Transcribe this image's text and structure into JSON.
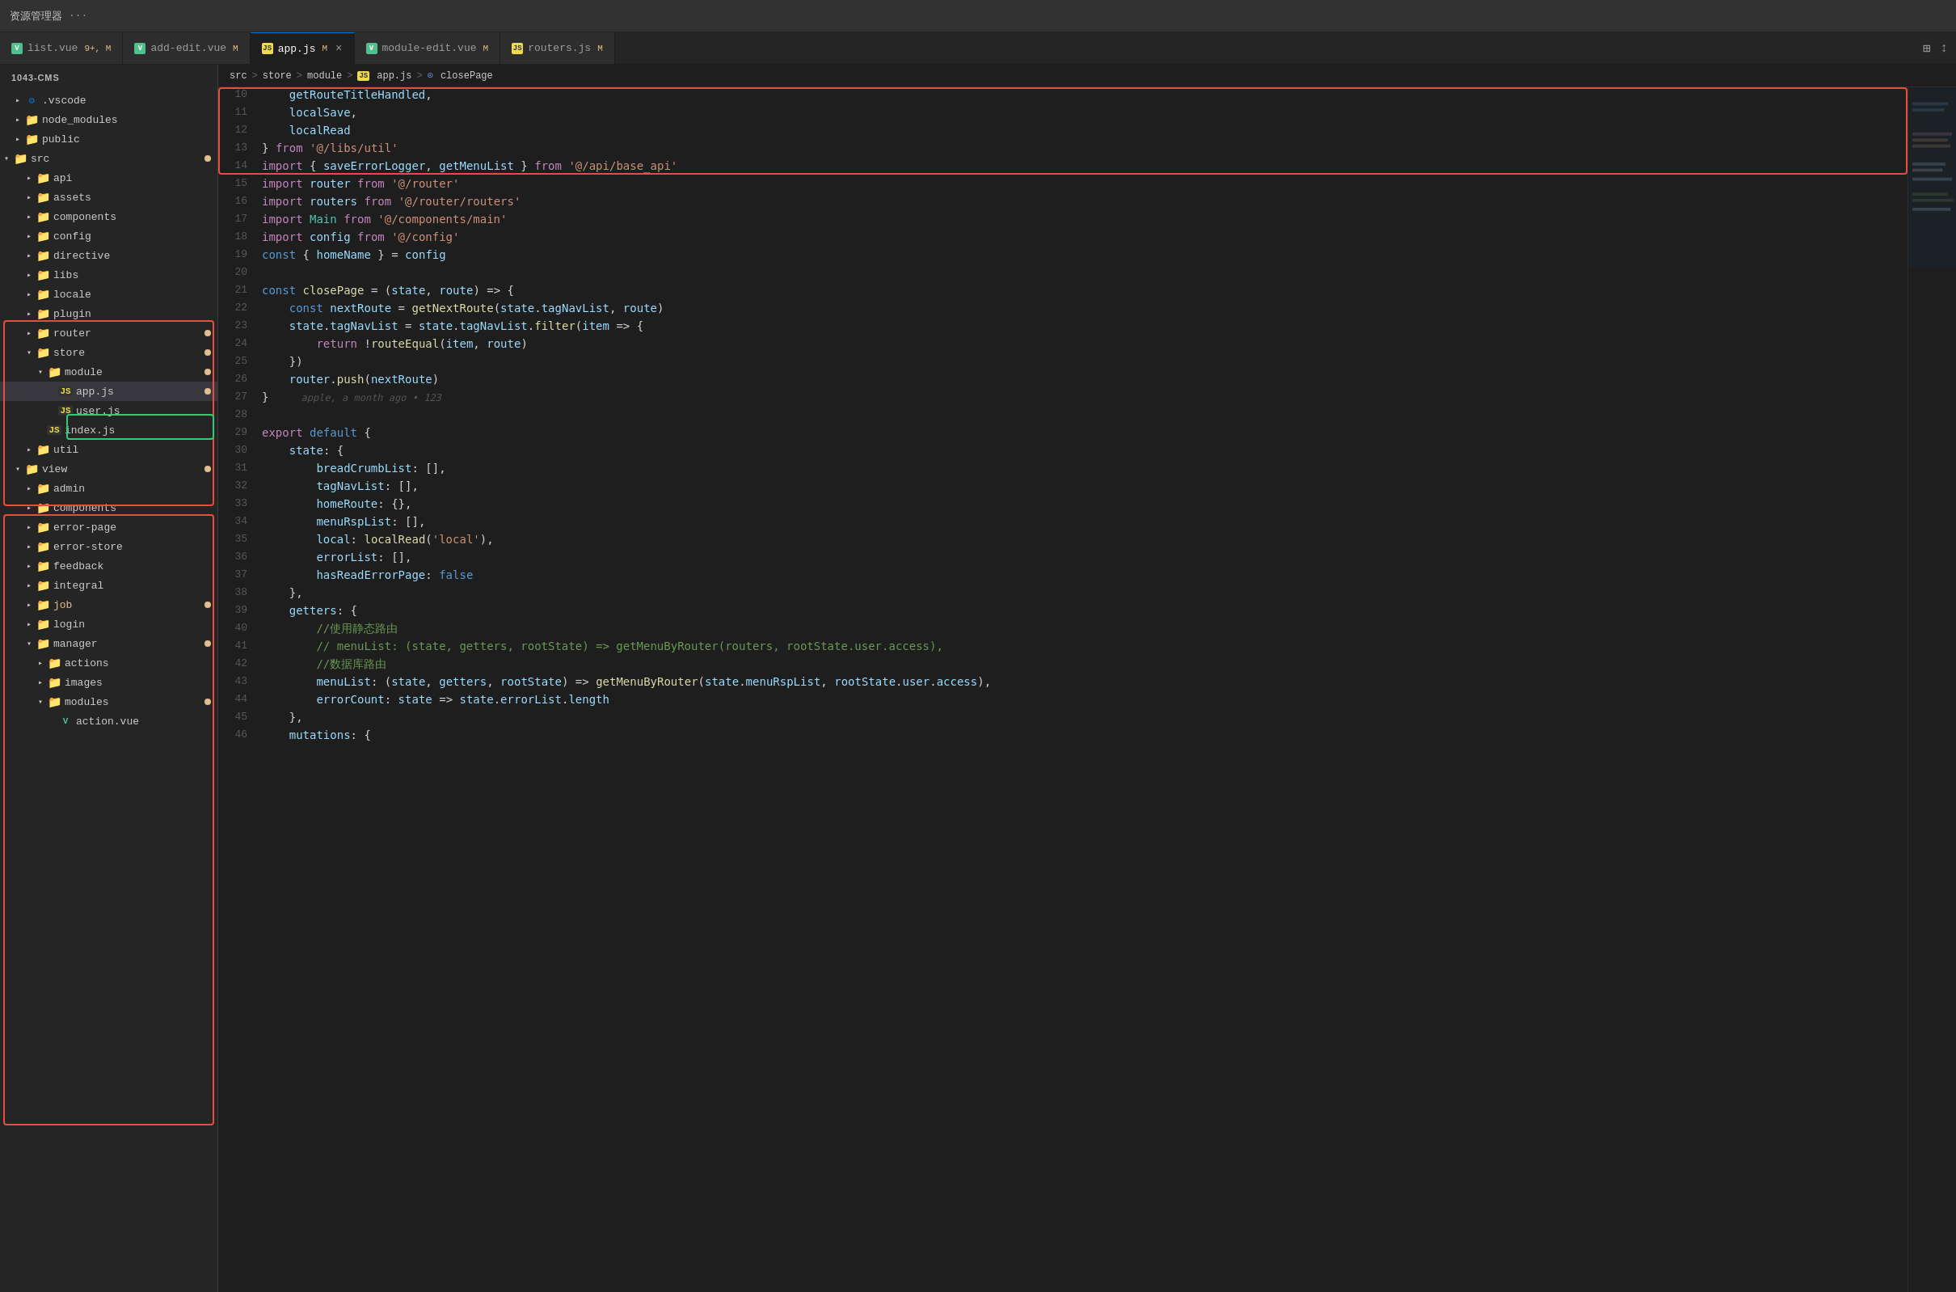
{
  "titleBar": {
    "explorerLabel": "资源管理器",
    "dotsLabel": "···"
  },
  "tabs": [
    {
      "id": "list-vue",
      "icon": "vue",
      "label": "list.vue",
      "badge": "9+, M",
      "active": false,
      "closeable": false
    },
    {
      "id": "add-edit-vue",
      "icon": "vue",
      "label": "add-edit.vue",
      "badge": "M",
      "active": false,
      "closeable": false
    },
    {
      "id": "app-js",
      "icon": "js",
      "label": "app.js",
      "badge": "M",
      "active": true,
      "closeable": true
    },
    {
      "id": "module-edit-vue",
      "icon": "vue",
      "label": "module-edit.vue",
      "badge": "M",
      "active": false,
      "closeable": false
    },
    {
      "id": "routers-js",
      "icon": "js",
      "label": "routers.js",
      "badge": "M",
      "active": false,
      "closeable": false
    }
  ],
  "breadcrumb": {
    "parts": [
      "src",
      ">",
      "store",
      ">",
      "module",
      ">",
      "JS app.js",
      ">",
      "closePage"
    ]
  },
  "sidebar": {
    "title": "1043-CMS",
    "items": [
      {
        "id": "vscode",
        "label": ".vscode",
        "type": "dir",
        "indent": 1,
        "open": false,
        "icon": "vscode"
      },
      {
        "id": "node_modules",
        "label": "node_modules",
        "type": "dir",
        "indent": 1,
        "open": false,
        "icon": "folder-special"
      },
      {
        "id": "public",
        "label": "public",
        "type": "dir",
        "indent": 1,
        "open": false,
        "icon": "folder"
      },
      {
        "id": "src",
        "label": "src",
        "type": "dir",
        "indent": 0,
        "open": true,
        "icon": "folder-special",
        "modified": true
      },
      {
        "id": "api",
        "label": "api",
        "type": "dir",
        "indent": 2,
        "open": false,
        "icon": "folder"
      },
      {
        "id": "assets",
        "label": "assets",
        "type": "dir",
        "indent": 2,
        "open": false,
        "icon": "folder-special"
      },
      {
        "id": "components",
        "label": "components",
        "type": "dir",
        "indent": 2,
        "open": false,
        "icon": "folder-special"
      },
      {
        "id": "config",
        "label": "config",
        "type": "dir",
        "indent": 2,
        "open": false,
        "icon": "folder"
      },
      {
        "id": "directive",
        "label": "directive",
        "type": "dir",
        "indent": 2,
        "open": false,
        "icon": "folder"
      },
      {
        "id": "libs",
        "label": "libs",
        "type": "dir",
        "indent": 2,
        "open": false,
        "icon": "folder"
      },
      {
        "id": "locale",
        "label": "locale",
        "type": "dir",
        "indent": 2,
        "open": false,
        "icon": "folder-special"
      },
      {
        "id": "plugin",
        "label": "plugin",
        "type": "dir",
        "indent": 2,
        "open": false,
        "icon": "folder"
      },
      {
        "id": "router",
        "label": "router",
        "type": "dir",
        "indent": 2,
        "open": false,
        "icon": "folder",
        "modified": true
      },
      {
        "id": "store",
        "label": "store",
        "type": "dir",
        "indent": 2,
        "open": true,
        "icon": "folder",
        "modified": true
      },
      {
        "id": "module",
        "label": "module",
        "type": "dir",
        "indent": 3,
        "open": true,
        "icon": "folder-special",
        "modified": true
      },
      {
        "id": "app-js-file",
        "label": "app.js",
        "type": "file-js",
        "indent": 4,
        "selected": true,
        "modified": true
      },
      {
        "id": "user-js-file",
        "label": "user.js",
        "type": "file-js",
        "indent": 4
      },
      {
        "id": "index-js-file",
        "label": "index.js",
        "type": "file-js",
        "indent": 3
      },
      {
        "id": "util",
        "label": "util",
        "type": "dir",
        "indent": 2,
        "open": false,
        "icon": "folder-special"
      },
      {
        "id": "view",
        "label": "view",
        "type": "dir",
        "indent": 1,
        "open": true,
        "icon": "folder-special",
        "modified": true
      },
      {
        "id": "admin",
        "label": "admin",
        "type": "dir",
        "indent": 2,
        "open": false,
        "icon": "folder"
      },
      {
        "id": "components2",
        "label": "components",
        "type": "dir",
        "indent": 2,
        "open": false,
        "icon": "folder-special"
      },
      {
        "id": "error-page",
        "label": "error-page",
        "type": "dir",
        "indent": 2,
        "open": false,
        "icon": "folder"
      },
      {
        "id": "error-store",
        "label": "error-store",
        "type": "dir",
        "indent": 2,
        "open": false,
        "icon": "folder"
      },
      {
        "id": "feedback",
        "label": "feedback",
        "type": "dir",
        "indent": 2,
        "open": false,
        "icon": "folder"
      },
      {
        "id": "integral",
        "label": "integral",
        "type": "dir",
        "indent": 2,
        "open": false,
        "icon": "folder"
      },
      {
        "id": "job",
        "label": "job",
        "type": "dir",
        "indent": 2,
        "open": false,
        "icon": "folder",
        "modified": true,
        "labelColor": "modified"
      },
      {
        "id": "login",
        "label": "login",
        "type": "dir",
        "indent": 2,
        "open": false,
        "icon": "folder"
      },
      {
        "id": "manager",
        "label": "manager",
        "type": "dir",
        "indent": 2,
        "open": true,
        "icon": "folder-special",
        "modified": true
      },
      {
        "id": "actions",
        "label": "actions",
        "type": "dir",
        "indent": 3,
        "open": false,
        "icon": "folder"
      },
      {
        "id": "images",
        "label": "images",
        "type": "dir",
        "indent": 3,
        "open": false,
        "icon": "folder-special"
      },
      {
        "id": "modules",
        "label": "modules",
        "type": "dir",
        "indent": 3,
        "open": true,
        "icon": "folder-special",
        "modified": true
      },
      {
        "id": "action-vue",
        "label": "action.vue",
        "type": "file-vue",
        "indent": 4
      }
    ]
  },
  "codeLines": [
    {
      "num": 10,
      "content": "    getRouteTitleHandled,"
    },
    {
      "num": 11,
      "content": "    localSave,"
    },
    {
      "num": 12,
      "content": "    localRead"
    },
    {
      "num": 13,
      "content": "} from '@/libs/util'"
    },
    {
      "num": 14,
      "content": "import { saveErrorLogger, getMenuList } from '@/api/base_api'"
    },
    {
      "num": 15,
      "content": "import router from '@/router'"
    },
    {
      "num": 16,
      "content": "import routers from '@/router/routers'"
    },
    {
      "num": 17,
      "content": "import Main from '@/components/main'"
    },
    {
      "num": 18,
      "content": "import config from '@/config'"
    },
    {
      "num": 19,
      "content": "const { homeName } = config"
    },
    {
      "num": 20,
      "content": ""
    },
    {
      "num": 21,
      "content": "const closePage = (state, route) => {"
    },
    {
      "num": 22,
      "content": "    const nextRoute = getNextRoute(state.tagNavList, route)"
    },
    {
      "num": 23,
      "content": "    state.tagNavList = state.tagNavList.filter(item => {"
    },
    {
      "num": 24,
      "content": "        return !routeEqual(item, route)"
    },
    {
      "num": 25,
      "content": "    })"
    },
    {
      "num": 26,
      "content": "    router.push(nextRoute)"
    },
    {
      "num": 27,
      "content": "}"
    },
    {
      "num": 28,
      "content": ""
    },
    {
      "num": 29,
      "content": "export default {"
    },
    {
      "num": 30,
      "content": "    state: {"
    },
    {
      "num": 31,
      "content": "        breadCrumbList: [],"
    },
    {
      "num": 32,
      "content": "        tagNavList: [],"
    },
    {
      "num": 33,
      "content": "        homeRoute: {},"
    },
    {
      "num": 34,
      "content": "        menuRspList: [],"
    },
    {
      "num": 35,
      "content": "        local: localRead('local'),"
    },
    {
      "num": 36,
      "content": "        errorList: [],"
    },
    {
      "num": 37,
      "content": "        hasReadErrorPage: false"
    },
    {
      "num": 38,
      "content": "    },"
    },
    {
      "num": 39,
      "content": "    getters: {"
    },
    {
      "num": 40,
      "content": "        //使用静态路由"
    },
    {
      "num": 41,
      "content": "        // menuList: (state, getters, rootState) => getMenuByRouter(routers, rootState.user.access),"
    },
    {
      "num": 42,
      "content": "        //数据库路由"
    },
    {
      "num": 43,
      "content": "        menuList: (state, getters, rootState) => getMenuByRouter(state.menuRspList, rootState.user.access),"
    },
    {
      "num": 44,
      "content": "        errorCount: state => state.errorList.length"
    },
    {
      "num": 45,
      "content": "    },"
    },
    {
      "num": 46,
      "content": "    mutations: {"
    }
  ],
  "blameText": "apple, a month ago • 123",
  "colors": {
    "activeTab": "#0078d4",
    "redBox": "#e74c3c",
    "greenBox": "#2ecc71"
  }
}
